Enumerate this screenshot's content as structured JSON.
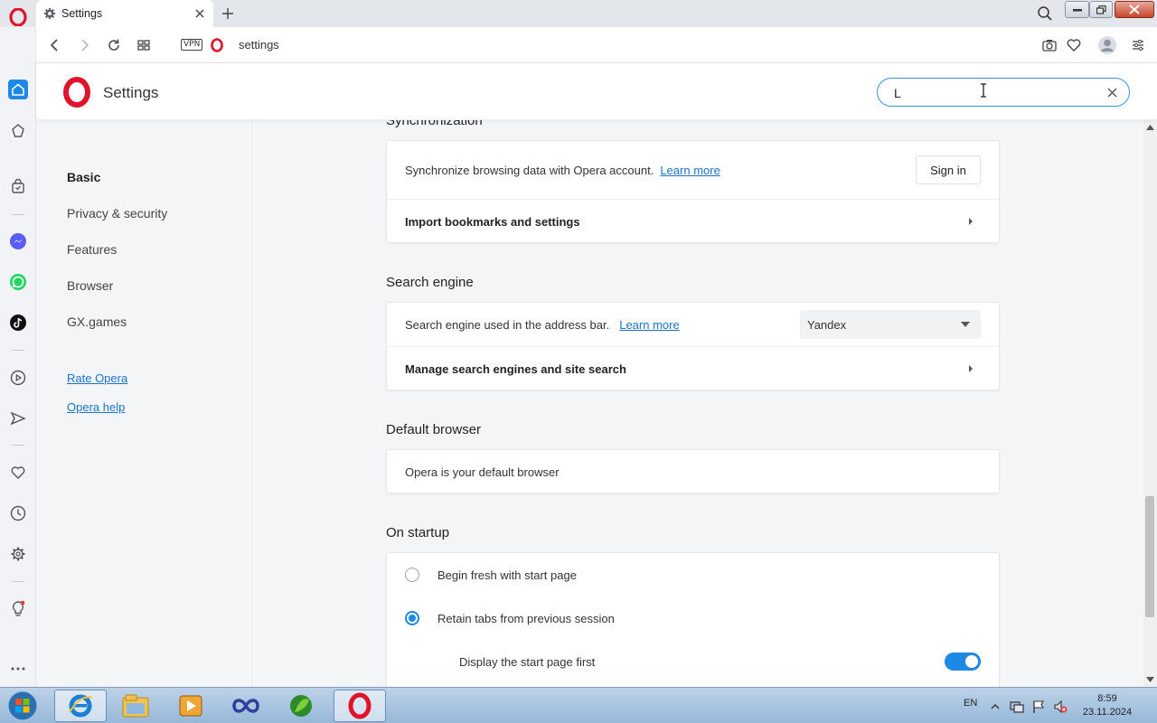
{
  "browser": {
    "tab_title": "Settings",
    "address": "settings",
    "vpn_label": "VPN"
  },
  "header": {
    "title": "Settings",
    "search_value": "L"
  },
  "leftnav": {
    "items": [
      {
        "label": "Basic",
        "active": true
      },
      {
        "label": "Privacy & security",
        "active": false
      },
      {
        "label": "Features",
        "active": false
      },
      {
        "label": "Browser",
        "active": false
      },
      {
        "label": "GX.games",
        "active": false
      }
    ],
    "links": [
      "Rate Opera",
      "Opera help"
    ]
  },
  "sections": {
    "sync": {
      "title": "Synchronization",
      "sync_text": "Synchronize browsing data with Opera account.",
      "learn_more": "Learn more",
      "signin_label": "Sign in",
      "import_label": "Import bookmarks and settings"
    },
    "search_engine": {
      "title": "Search engine",
      "text": "Search engine used in the address bar.",
      "learn_more": "Learn more",
      "selected": "Yandex",
      "manage_label": "Manage search engines and site search"
    },
    "default_browser": {
      "title": "Default browser",
      "text": "Opera is your default browser"
    },
    "startup": {
      "title": "On startup",
      "option1": "Begin fresh with start page",
      "option2": "Retain tabs from previous session",
      "selected_option": 2,
      "sub_option": "Display the start page first",
      "sub_option_on": true
    }
  },
  "taskbar": {
    "lang": "EN",
    "time": "8:59",
    "date": "23.11.2024"
  },
  "colors": {
    "accent": "#1e88e5",
    "link": "#1a73c9",
    "opera_red": "#e0132b"
  }
}
